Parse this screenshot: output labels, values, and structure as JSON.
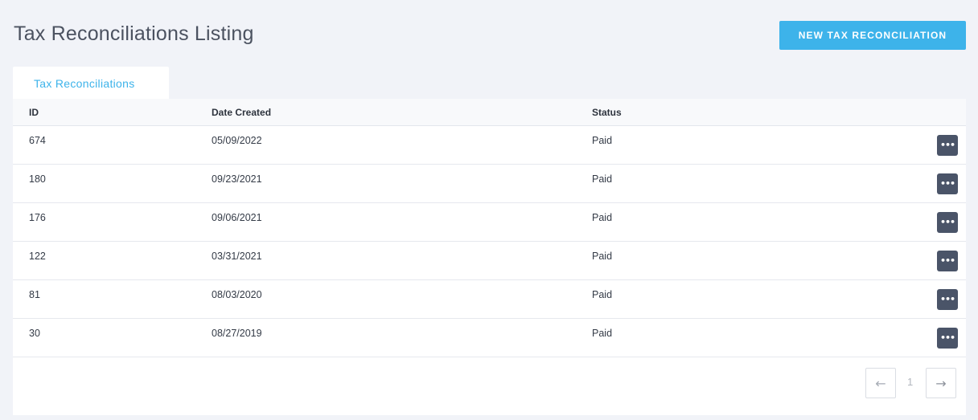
{
  "header": {
    "title": "Tax Reconciliations Listing",
    "new_button_label": "New Tax Reconciliation"
  },
  "tabs": [
    {
      "label": "Tax Reconciliations",
      "active": true
    }
  ],
  "table": {
    "columns": [
      "ID",
      "Date Created",
      "Status"
    ],
    "rows": [
      {
        "id": "674",
        "date": "05/09/2022",
        "status": "Paid",
        "action": "•••"
      },
      {
        "id": "180",
        "date": "09/23/2021",
        "status": "Paid",
        "action": "•••"
      },
      {
        "id": "176",
        "date": "09/06/2021",
        "status": "Paid",
        "action": "•••"
      },
      {
        "id": "122",
        "date": "03/31/2021",
        "status": "Paid",
        "action": "•••"
      },
      {
        "id": "81",
        "date": "08/03/2020",
        "status": "Paid",
        "action": "•••"
      },
      {
        "id": "30",
        "date": "08/27/2019",
        "status": "Paid",
        "action": "•••"
      }
    ]
  },
  "pagination": {
    "prev_icon": "←",
    "current_page": "1",
    "next_icon": "→"
  },
  "icons": {
    "more": "ellipsis-horizontal-icon",
    "prev": "arrow-left-icon",
    "next": "arrow-right-icon"
  },
  "colors": {
    "accent": "#3db3ea",
    "action_button": "#4a5468",
    "background": "#f1f3f8"
  }
}
